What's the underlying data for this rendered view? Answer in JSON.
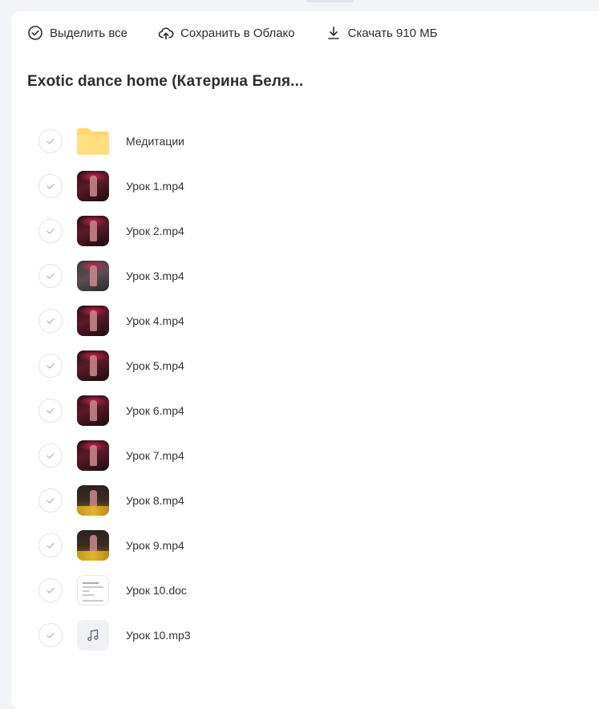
{
  "toolbar": {
    "select_all": "Выделить все",
    "save_to_cloud": "Сохранить в Облако",
    "download": "Скачать 910 МБ"
  },
  "folder_title": "Exotic dance home (Катерина Беля...",
  "files": [
    {
      "name": "Медитации",
      "type": "folder"
    },
    {
      "name": "Урок 1.mp4",
      "type": "video"
    },
    {
      "name": "Урок 2.mp4",
      "type": "video"
    },
    {
      "name": "Урок 3.mp4",
      "type": "video"
    },
    {
      "name": "Урок 4.mp4",
      "type": "video"
    },
    {
      "name": "Урок 5.mp4",
      "type": "video"
    },
    {
      "name": "Урок 6.mp4",
      "type": "video"
    },
    {
      "name": "Урок 7.mp4",
      "type": "video"
    },
    {
      "name": "Урок 8.mp4",
      "type": "video"
    },
    {
      "name": "Урок 9.mp4",
      "type": "video"
    },
    {
      "name": "Урок 10.doc",
      "type": "document"
    },
    {
      "name": "Урок 10.mp3",
      "type": "audio"
    }
  ],
  "colors": {
    "folder": "#ffd76a",
    "accent_text": "#2c2d2e"
  },
  "icons": {
    "select_all": "check-circle-icon",
    "save_to_cloud": "cloud-upload-icon",
    "download": "download-icon",
    "row_check": "check-icon",
    "audio": "music-note-icon"
  }
}
